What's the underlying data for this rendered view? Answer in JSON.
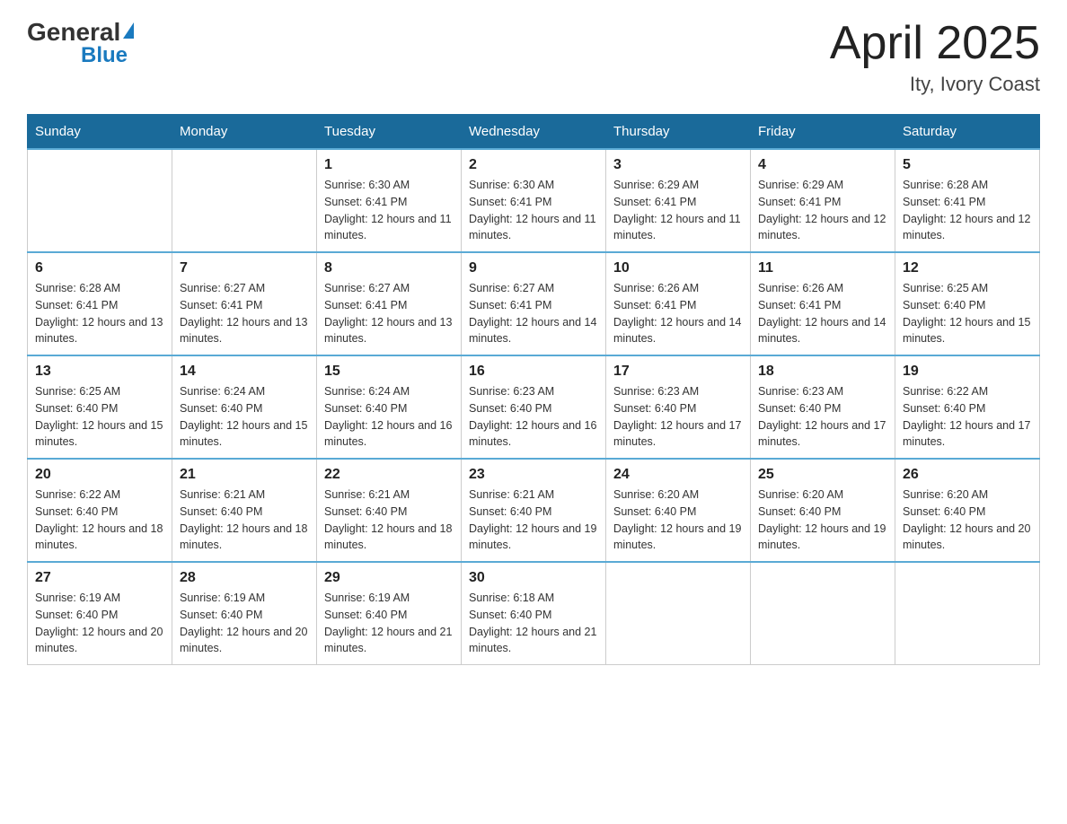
{
  "header": {
    "logo_general": "General",
    "logo_blue": "Blue",
    "month_title": "April 2025",
    "location": "Ity, Ivory Coast"
  },
  "weekdays": [
    "Sunday",
    "Monday",
    "Tuesday",
    "Wednesday",
    "Thursday",
    "Friday",
    "Saturday"
  ],
  "weeks": [
    [
      {
        "day": "",
        "sunrise": "",
        "sunset": "",
        "daylight": ""
      },
      {
        "day": "",
        "sunrise": "",
        "sunset": "",
        "daylight": ""
      },
      {
        "day": "1",
        "sunrise": "Sunrise: 6:30 AM",
        "sunset": "Sunset: 6:41 PM",
        "daylight": "Daylight: 12 hours and 11 minutes."
      },
      {
        "day": "2",
        "sunrise": "Sunrise: 6:30 AM",
        "sunset": "Sunset: 6:41 PM",
        "daylight": "Daylight: 12 hours and 11 minutes."
      },
      {
        "day": "3",
        "sunrise": "Sunrise: 6:29 AM",
        "sunset": "Sunset: 6:41 PM",
        "daylight": "Daylight: 12 hours and 11 minutes."
      },
      {
        "day": "4",
        "sunrise": "Sunrise: 6:29 AM",
        "sunset": "Sunset: 6:41 PM",
        "daylight": "Daylight: 12 hours and 12 minutes."
      },
      {
        "day": "5",
        "sunrise": "Sunrise: 6:28 AM",
        "sunset": "Sunset: 6:41 PM",
        "daylight": "Daylight: 12 hours and 12 minutes."
      }
    ],
    [
      {
        "day": "6",
        "sunrise": "Sunrise: 6:28 AM",
        "sunset": "Sunset: 6:41 PM",
        "daylight": "Daylight: 12 hours and 13 minutes."
      },
      {
        "day": "7",
        "sunrise": "Sunrise: 6:27 AM",
        "sunset": "Sunset: 6:41 PM",
        "daylight": "Daylight: 12 hours and 13 minutes."
      },
      {
        "day": "8",
        "sunrise": "Sunrise: 6:27 AM",
        "sunset": "Sunset: 6:41 PM",
        "daylight": "Daylight: 12 hours and 13 minutes."
      },
      {
        "day": "9",
        "sunrise": "Sunrise: 6:27 AM",
        "sunset": "Sunset: 6:41 PM",
        "daylight": "Daylight: 12 hours and 14 minutes."
      },
      {
        "day": "10",
        "sunrise": "Sunrise: 6:26 AM",
        "sunset": "Sunset: 6:41 PM",
        "daylight": "Daylight: 12 hours and 14 minutes."
      },
      {
        "day": "11",
        "sunrise": "Sunrise: 6:26 AM",
        "sunset": "Sunset: 6:41 PM",
        "daylight": "Daylight: 12 hours and 14 minutes."
      },
      {
        "day": "12",
        "sunrise": "Sunrise: 6:25 AM",
        "sunset": "Sunset: 6:40 PM",
        "daylight": "Daylight: 12 hours and 15 minutes."
      }
    ],
    [
      {
        "day": "13",
        "sunrise": "Sunrise: 6:25 AM",
        "sunset": "Sunset: 6:40 PM",
        "daylight": "Daylight: 12 hours and 15 minutes."
      },
      {
        "day": "14",
        "sunrise": "Sunrise: 6:24 AM",
        "sunset": "Sunset: 6:40 PM",
        "daylight": "Daylight: 12 hours and 15 minutes."
      },
      {
        "day": "15",
        "sunrise": "Sunrise: 6:24 AM",
        "sunset": "Sunset: 6:40 PM",
        "daylight": "Daylight: 12 hours and 16 minutes."
      },
      {
        "day": "16",
        "sunrise": "Sunrise: 6:23 AM",
        "sunset": "Sunset: 6:40 PM",
        "daylight": "Daylight: 12 hours and 16 minutes."
      },
      {
        "day": "17",
        "sunrise": "Sunrise: 6:23 AM",
        "sunset": "Sunset: 6:40 PM",
        "daylight": "Daylight: 12 hours and 17 minutes."
      },
      {
        "day": "18",
        "sunrise": "Sunrise: 6:23 AM",
        "sunset": "Sunset: 6:40 PM",
        "daylight": "Daylight: 12 hours and 17 minutes."
      },
      {
        "day": "19",
        "sunrise": "Sunrise: 6:22 AM",
        "sunset": "Sunset: 6:40 PM",
        "daylight": "Daylight: 12 hours and 17 minutes."
      }
    ],
    [
      {
        "day": "20",
        "sunrise": "Sunrise: 6:22 AM",
        "sunset": "Sunset: 6:40 PM",
        "daylight": "Daylight: 12 hours and 18 minutes."
      },
      {
        "day": "21",
        "sunrise": "Sunrise: 6:21 AM",
        "sunset": "Sunset: 6:40 PM",
        "daylight": "Daylight: 12 hours and 18 minutes."
      },
      {
        "day": "22",
        "sunrise": "Sunrise: 6:21 AM",
        "sunset": "Sunset: 6:40 PM",
        "daylight": "Daylight: 12 hours and 18 minutes."
      },
      {
        "day": "23",
        "sunrise": "Sunrise: 6:21 AM",
        "sunset": "Sunset: 6:40 PM",
        "daylight": "Daylight: 12 hours and 19 minutes."
      },
      {
        "day": "24",
        "sunrise": "Sunrise: 6:20 AM",
        "sunset": "Sunset: 6:40 PM",
        "daylight": "Daylight: 12 hours and 19 minutes."
      },
      {
        "day": "25",
        "sunrise": "Sunrise: 6:20 AM",
        "sunset": "Sunset: 6:40 PM",
        "daylight": "Daylight: 12 hours and 19 minutes."
      },
      {
        "day": "26",
        "sunrise": "Sunrise: 6:20 AM",
        "sunset": "Sunset: 6:40 PM",
        "daylight": "Daylight: 12 hours and 20 minutes."
      }
    ],
    [
      {
        "day": "27",
        "sunrise": "Sunrise: 6:19 AM",
        "sunset": "Sunset: 6:40 PM",
        "daylight": "Daylight: 12 hours and 20 minutes."
      },
      {
        "day": "28",
        "sunrise": "Sunrise: 6:19 AM",
        "sunset": "Sunset: 6:40 PM",
        "daylight": "Daylight: 12 hours and 20 minutes."
      },
      {
        "day": "29",
        "sunrise": "Sunrise: 6:19 AM",
        "sunset": "Sunset: 6:40 PM",
        "daylight": "Daylight: 12 hours and 21 minutes."
      },
      {
        "day": "30",
        "sunrise": "Sunrise: 6:18 AM",
        "sunset": "Sunset: 6:40 PM",
        "daylight": "Daylight: 12 hours and 21 minutes."
      },
      {
        "day": "",
        "sunrise": "",
        "sunset": "",
        "daylight": ""
      },
      {
        "day": "",
        "sunrise": "",
        "sunset": "",
        "daylight": ""
      },
      {
        "day": "",
        "sunrise": "",
        "sunset": "",
        "daylight": ""
      }
    ]
  ]
}
